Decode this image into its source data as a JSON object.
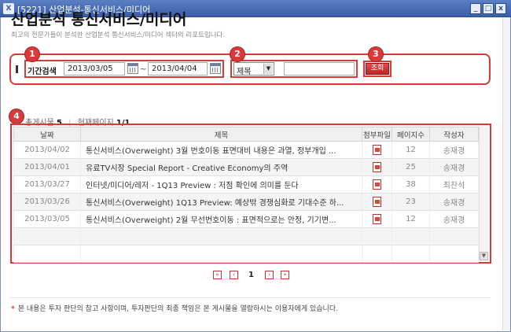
{
  "window": {
    "title": "[5221] 산업분석-통신서비스/미디어",
    "app_icon": "X",
    "min_label": "_",
    "max_label": "□",
    "close_label": "x"
  },
  "header": {
    "title": "산업분석 통신서비스/미디어",
    "subtitle": "최고의 전문가들이 분석한 산업분석 통신서비스/미디어 섹터의 리포트입니다."
  },
  "markers": [
    "1",
    "2",
    "3",
    "4"
  ],
  "search": {
    "period_label": "기간검색",
    "date_from": "2013/03/05",
    "date_to": "2013/04/04",
    "tilde": "~",
    "field_select": "제목",
    "keyword_value": "",
    "button_label": "조회"
  },
  "count": {
    "total_label": "총게시물",
    "total_value": "5",
    "separator": "|",
    "page_label": "현재페이지",
    "page_value": "1/1"
  },
  "table": {
    "headers": [
      "날짜",
      "제목",
      "첨부파일",
      "페이지수",
      "작성자"
    ],
    "rows": [
      {
        "date": "2013/04/02",
        "subject": "통신서비스(Overweight) 3월 번호이동 표면대비 내용은 과열, 정부개입 ...",
        "pages": "12",
        "author": "송재경"
      },
      {
        "date": "2013/04/01",
        "subject": "유료TV시장 Special Report - Creative Economy의 주역",
        "pages": "25",
        "author": "송재경"
      },
      {
        "date": "2013/03/27",
        "subject": "인터넷/미디어/레저 - 1Q13 Preview : 저점 확인에 의미를 둔다",
        "pages": "38",
        "author": "최찬석"
      },
      {
        "date": "2013/03/26",
        "subject": "통신서비스(Overweight) 1Q13 Preview: 예상밖 경쟁심화로 기대수준 하...",
        "pages": "23",
        "author": "송재경"
      },
      {
        "date": "2013/03/05",
        "subject": "통신서비스(Overweight) 2월 무선번호이동 : 표면적으로는 안정, 기기변...",
        "pages": "12",
        "author": "송재경"
      }
    ]
  },
  "pager": {
    "first": "«",
    "prev": "‹",
    "current": "1",
    "next": "›",
    "last": "»"
  },
  "footer": {
    "note": "본 내용은 투자 판단의 참고 사항이며, 투자판단의 최종 책임은 본 게시물을 열람하시는 이용자에게 있습니다."
  },
  "icons": {
    "calendar": "calendar-icon",
    "pdf": "pdf-icon"
  },
  "colors": {
    "accent": "#d83a3a",
    "title_bar": "#3a5ea8"
  }
}
